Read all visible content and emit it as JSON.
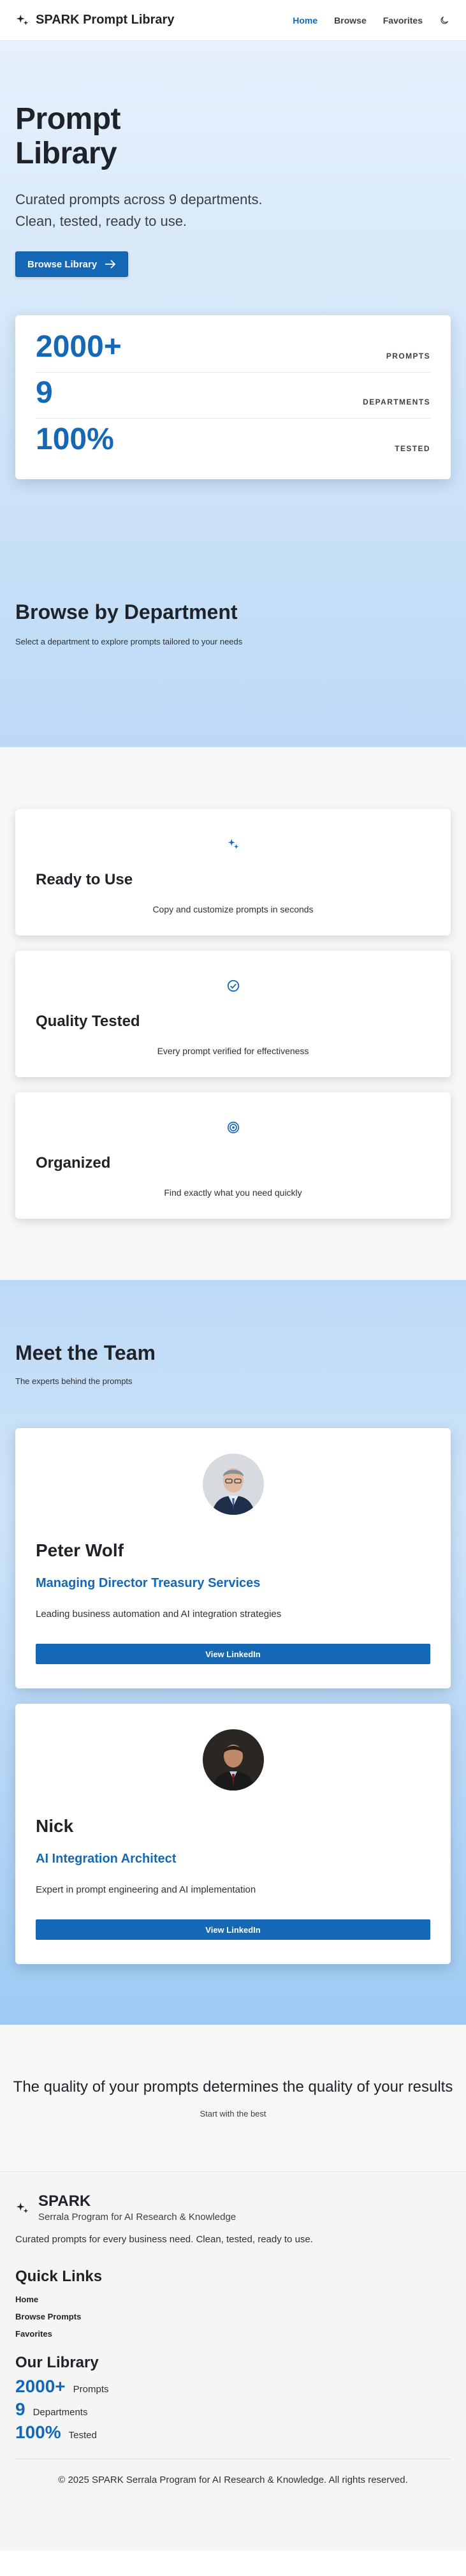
{
  "header": {
    "brand": "SPARK Prompt Library",
    "nav": [
      {
        "label": "Home",
        "active": true
      },
      {
        "label": "Browse",
        "active": false
      },
      {
        "label": "Favorites",
        "active": false
      }
    ],
    "theme_toggle_icon": "moon-icon"
  },
  "hero": {
    "title_line1": "Prompt",
    "title_line2": "Library",
    "subtitle_line1": "Curated prompts across 9 departments.",
    "subtitle_line2": "Clean, tested, ready to use.",
    "cta_label": "Browse Library",
    "stats": [
      {
        "value": "2000+",
        "label": "PROMPTS"
      },
      {
        "value": "9",
        "label": "DEPARTMENTS"
      },
      {
        "value": "100%",
        "label": "TESTED"
      }
    ]
  },
  "departments": {
    "title": "Browse by Department",
    "subtitle": "Select a department to explore prompts tailored to your needs"
  },
  "features": [
    {
      "icon": "sparkle-icon",
      "title": "Ready to Use",
      "desc": "Copy and customize prompts in seconds"
    },
    {
      "icon": "check-circle-icon",
      "title": "Quality Tested",
      "desc": "Every prompt verified for effectiveness"
    },
    {
      "icon": "target-icon",
      "title": "Organized",
      "desc": "Find exactly what you need quickly"
    }
  ],
  "team": {
    "title": "Meet the Team",
    "subtitle": "The experts behind the prompts",
    "members": [
      {
        "name": "Peter Wolf",
        "role": "Managing Director Treasury Services",
        "desc": "Leading business automation and AI integration strategies",
        "button": "View LinkedIn"
      },
      {
        "name": "Nick",
        "role": "AI Integration Architect",
        "desc": "Expert in prompt engineering and AI implementation",
        "button": "View LinkedIn"
      }
    ]
  },
  "quote": {
    "text": "The quality of your prompts determines the quality of your results",
    "sub": "Start with the best"
  },
  "footer": {
    "brand": "SPARK",
    "brand_full": "Serrala Program for AI Research & Knowledge",
    "desc": "Curated prompts for every business need. Clean, tested, ready to use.",
    "quick_links_title": "Quick Links",
    "links": [
      "Home",
      "Browse Prompts",
      "Favorites"
    ],
    "library_title": "Our Library",
    "library_stats": [
      {
        "value": "2000+",
        "label": "Prompts"
      },
      {
        "value": "9",
        "label": "Departments"
      },
      {
        "value": "100%",
        "label": "Tested"
      }
    ],
    "copyright": "© 2025 SPARK Serrala Program for AI Research & Knowledge. All rights reserved."
  },
  "colors": {
    "accent": "#1468b6",
    "text": "#1f2329",
    "hero_bg_top": "#e6f1fc",
    "hero_bg_bottom": "#bdd9f6"
  }
}
